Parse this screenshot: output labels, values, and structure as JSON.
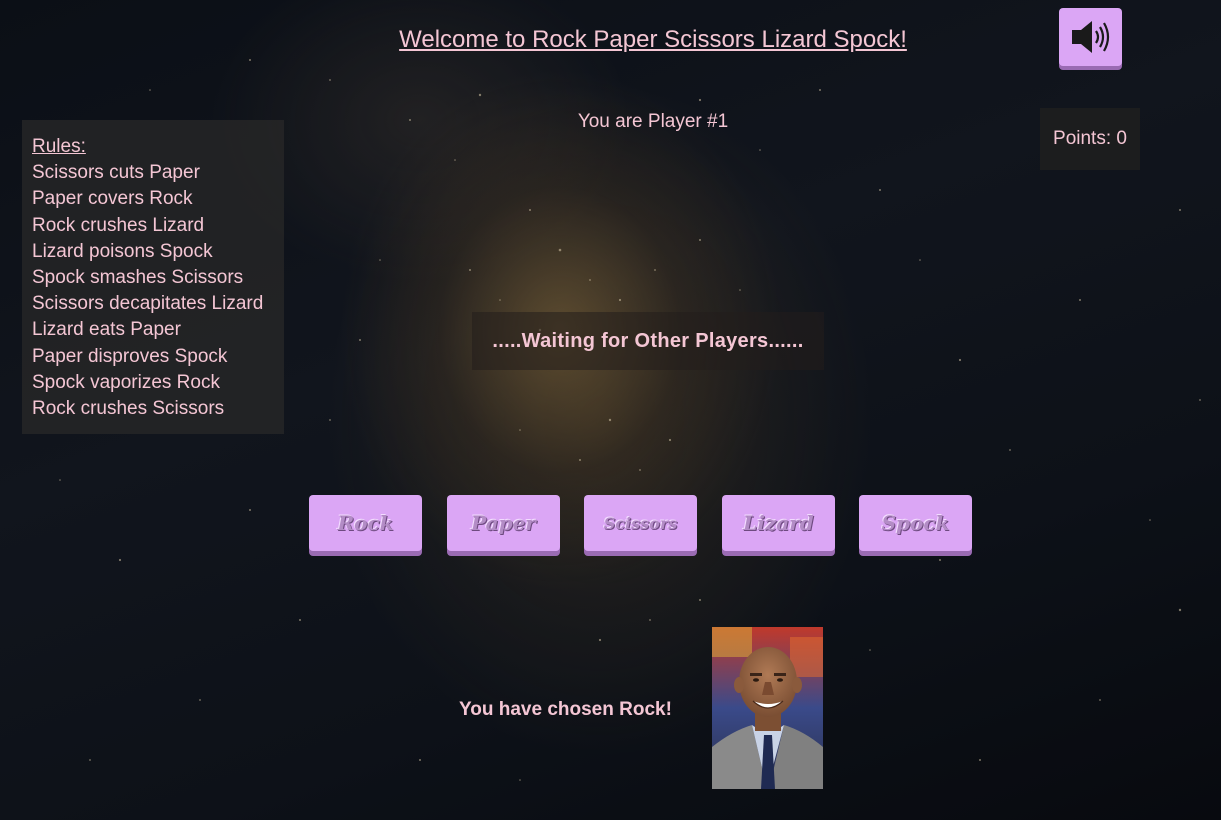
{
  "header": {
    "title": "Welcome to Rock Paper Scissors Lizard Spock!",
    "sound_icon": "speaker-volume-icon"
  },
  "player": {
    "label": "You are Player #1"
  },
  "points": {
    "label": "Points: 0"
  },
  "rules": {
    "heading": "Rules:",
    "items": [
      "Scissors cuts Paper",
      "Paper covers Rock",
      "Rock crushes Lizard",
      "Lizard poisons Spock",
      "Spock smashes Scissors",
      "Scissors decapitates Lizard",
      "Lizard eats Paper",
      "Paper disproves Spock",
      "Spock vaporizes Rock",
      "Rock crushes Scissors"
    ]
  },
  "status": {
    "waiting": ".....Waiting for Other Players......"
  },
  "choices": [
    "Rock",
    "Paper",
    "Scissors",
    "Lizard",
    "Spock"
  ],
  "selection": {
    "label": "You have chosen Rock!",
    "image": "choice-portrait-photo"
  },
  "colors": {
    "button_fill": "#dba6f5",
    "button_shadow": "#9a6bb3",
    "text_pink": "#f4c6d4",
    "background": "#0d1118"
  }
}
